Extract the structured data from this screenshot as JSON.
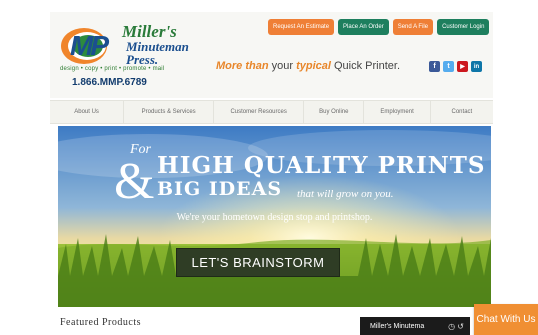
{
  "header": {
    "logo": {
      "line1": "Miller's",
      "line2": "Minuteman",
      "line3": "Press.",
      "monogram": "MP"
    },
    "services_line": "design • copy • print • promote • mail",
    "phone": "1.866.MMP.6789",
    "slogan": {
      "emph1": "More than",
      "middle": " your ",
      "emph2": "typical",
      "rest": " Quick Printer."
    },
    "buttons": [
      {
        "label": "Request An Estimate",
        "color": "#ef7f36"
      },
      {
        "label": "Place An Order",
        "color": "#1e7f5e"
      },
      {
        "label": "Send A File",
        "color": "#ef7f36"
      },
      {
        "label": "Customer Login",
        "color": "#1e7f5e"
      }
    ],
    "social": [
      {
        "icon": "facebook-icon",
        "glyph": "f",
        "color": "#3b5998"
      },
      {
        "icon": "twitter-icon",
        "glyph": "t",
        "color": "#55acee"
      },
      {
        "icon": "youtube-icon",
        "glyph": "▶",
        "color": "#cc181e"
      },
      {
        "icon": "linkedin-icon",
        "glyph": "in",
        "color": "#0e76a8"
      }
    ]
  },
  "nav": {
    "items": [
      {
        "label": "About Us"
      },
      {
        "label": "Products & Services"
      },
      {
        "label": "Customer Resources"
      },
      {
        "label": "Buy Online"
      },
      {
        "label": "Employment"
      },
      {
        "label": "Contact"
      }
    ]
  },
  "hero": {
    "for_text": "For",
    "ampersand": "&",
    "line1": "HIGH QUALITY PRINTS",
    "line2": "BIG IDEAS",
    "tail": "that will grow on you.",
    "sub": "We're your hometown design stop and printshop.",
    "cta": "LET'S BRAINSTORM"
  },
  "featured": {
    "title": "Featured Products"
  },
  "video": {
    "title": "Miller's Minutema"
  },
  "chat": {
    "label": "Chat With Us"
  }
}
